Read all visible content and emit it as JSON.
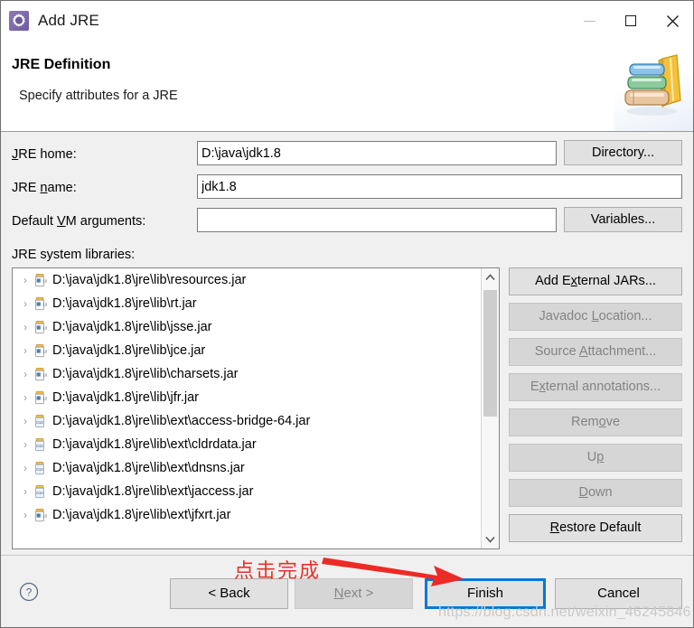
{
  "window": {
    "title": "Add JRE",
    "icon": "jre-gear-icon",
    "buttons": {
      "minimize": "minimize-icon",
      "maximize": "maximize-icon",
      "close": "close-icon"
    }
  },
  "header": {
    "title": "JRE Definition",
    "subtitle": "Specify attributes for a JRE",
    "graphic": "books-icon"
  },
  "form": {
    "jre_home": {
      "label_pre": "J",
      "label_post": "RE home:",
      "value": "D:\\java\\jdk1.8",
      "button": {
        "pre": "Directory...",
        "mnemonic": ""
      }
    },
    "jre_name": {
      "label_pre": "JRE ",
      "label_mn": "n",
      "label_post": "ame:",
      "value": "jdk1.8"
    },
    "vm_args": {
      "label_pre": "Default ",
      "label_mn": "V",
      "label_post": "M arguments:",
      "value": "",
      "button": "Variables..."
    },
    "directory_button": "Directory...",
    "variables_button": "Variables...",
    "libraries_label": "JRE system libraries:"
  },
  "libraries": [
    {
      "path": "D:\\java\\jdk1.8\\jre\\lib\\resources.jar",
      "icon": "jar-lib-icon"
    },
    {
      "path": "D:\\java\\jdk1.8\\jre\\lib\\rt.jar",
      "icon": "jar-lib-icon"
    },
    {
      "path": "D:\\java\\jdk1.8\\jre\\lib\\jsse.jar",
      "icon": "jar-lib-icon"
    },
    {
      "path": "D:\\java\\jdk1.8\\jre\\lib\\jce.jar",
      "icon": "jar-lib-icon"
    },
    {
      "path": "D:\\java\\jdk1.8\\jre\\lib\\charsets.jar",
      "icon": "jar-lib-icon"
    },
    {
      "path": "D:\\java\\jdk1.8\\jre\\lib\\jfr.jar",
      "icon": "jar-lib-icon"
    },
    {
      "path": "D:\\java\\jdk1.8\\jre\\lib\\ext\\access-bridge-64.jar",
      "icon": "jar-ext-icon"
    },
    {
      "path": "D:\\java\\jdk1.8\\jre\\lib\\ext\\cldrdata.jar",
      "icon": "jar-ext-icon"
    },
    {
      "path": "D:\\java\\jdk1.8\\jre\\lib\\ext\\dnsns.jar",
      "icon": "jar-ext-icon"
    },
    {
      "path": "D:\\java\\jdk1.8\\jre\\lib\\ext\\jaccess.jar",
      "icon": "jar-ext-icon"
    },
    {
      "path": "D:\\java\\jdk1.8\\jre\\lib\\ext\\jfxrt.jar",
      "icon": "jar-lib-icon"
    }
  ],
  "library_buttons": [
    {
      "label": "Add External JARs...",
      "mnemonic_index": 5,
      "enabled": true
    },
    {
      "label": "Javadoc Location...",
      "mnemonic_index": 8,
      "enabled": false
    },
    {
      "label": "Source Attachment...",
      "mnemonic_index": 7,
      "enabled": false
    },
    {
      "label": "External annotations...",
      "mnemonic_index": 1,
      "enabled": false
    },
    {
      "label": "Remove",
      "mnemonic_index": 3,
      "enabled": false
    },
    {
      "label": "Up",
      "mnemonic_index": 1,
      "enabled": false
    },
    {
      "label": "Down",
      "mnemonic_index": 0,
      "enabled": false
    },
    {
      "label": "Restore Default",
      "mnemonic_index": 0,
      "enabled": true
    }
  ],
  "footer": {
    "help": "help-icon",
    "back": "< Back",
    "next": "Next >",
    "next_mnemonic_index": 0,
    "finish": "Finish",
    "cancel": "Cancel"
  },
  "annotation": {
    "text": "点击完成",
    "color": "#e8312a",
    "arrow": "red-arrow-icon"
  },
  "watermark": "https://blog.csdn.net/weixin_46245846",
  "colors": {
    "focus_blue": "#0078d7",
    "dialog_bg": "#f0f0f0",
    "button_bg": "#e1e1e1",
    "annotation_red": "#e8312a"
  }
}
